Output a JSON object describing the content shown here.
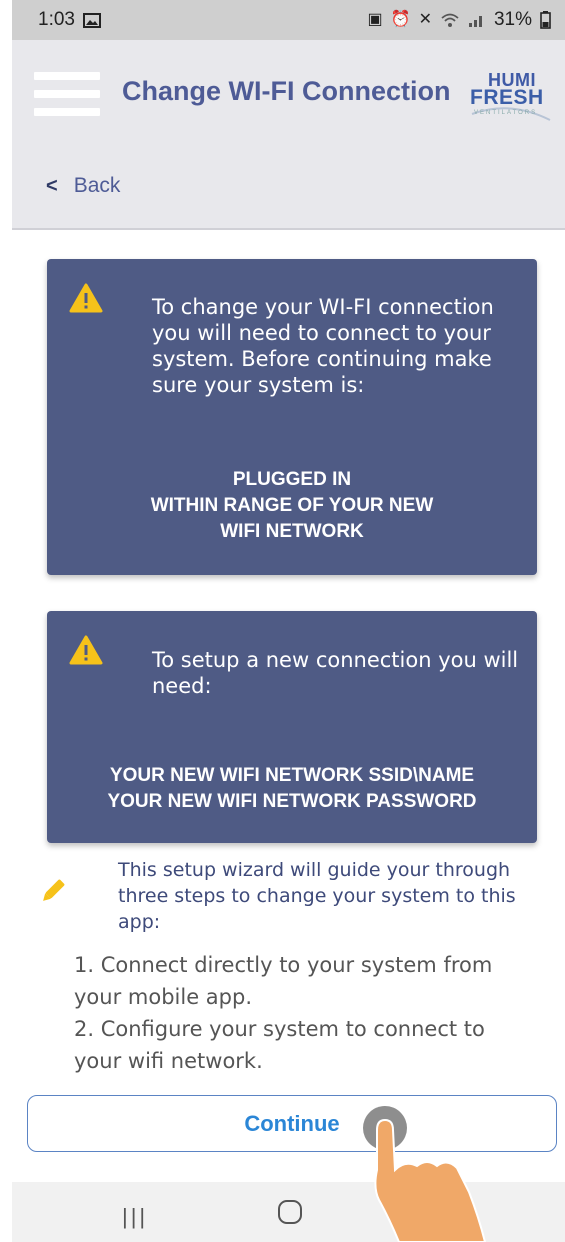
{
  "status": {
    "time": "1:03",
    "battery": "31%"
  },
  "header": {
    "title": "Change WI-FI Connection",
    "logo_top": "HUMI",
    "logo_bottom": "FRESH",
    "logo_tagline": "VENTILATORS"
  },
  "back": {
    "label": "Back"
  },
  "card1": {
    "message": "To change your WI-FI connection you will need to connect to your system. Before continuing make sure your system is:",
    "requirements": [
      "PLUGGED IN",
      "WITHIN RANGE OF YOUR NEW",
      "WIFI NETWORK"
    ]
  },
  "card2": {
    "message": "To setup a new connection you will need:",
    "requirements": [
      "YOUR NEW WIFI NETWORK SSID\\NAME",
      "YOUR NEW WIFI NETWORK PASSWORD"
    ]
  },
  "info": {
    "text": "This setup wizard will guide your through three steps to change your system to this app:"
  },
  "steps": {
    "step1": "1. Connect directly to your system from your mobile app.",
    "step2": "2. Configure your system to connect to your wifi network."
  },
  "continue_label": "Continue",
  "colors": {
    "card": "#4f5b85",
    "accent": "#4e5b96",
    "warning": "#f6c21a",
    "button_text": "#2b86d6"
  }
}
